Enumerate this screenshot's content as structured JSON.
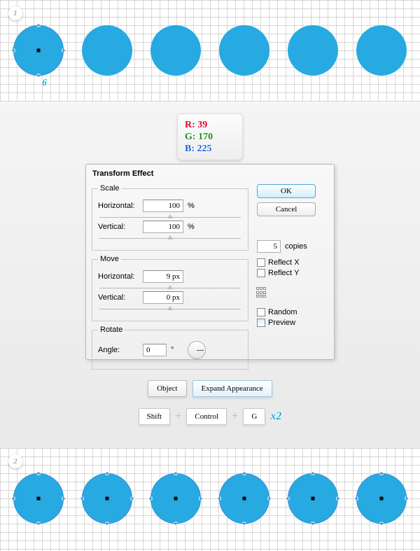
{
  "steps": {
    "s1": "1",
    "s2": "2"
  },
  "dims": {
    "w": "6",
    "h": "6"
  },
  "rgb": {
    "r_label": "R:",
    "g_label": "G:",
    "b_label": "B:",
    "r": "39",
    "g": "170",
    "b": "225"
  },
  "dialog": {
    "title": "Transform Effect",
    "scale": {
      "legend": "Scale",
      "h_label": "Horizontal:",
      "h_value": "100",
      "h_unit": "%",
      "v_label": "Vertical:",
      "v_value": "100",
      "v_unit": "%"
    },
    "move": {
      "legend": "Move",
      "h_label": "Horizontal:",
      "h_value": "9 px",
      "v_label": "Vertical:",
      "v_value": "0 px"
    },
    "rotate": {
      "legend": "Rotate",
      "angle_label": "Angle:",
      "angle_value": "0",
      "angle_unit": "°"
    },
    "buttons": {
      "ok": "OK",
      "cancel": "Cancel"
    },
    "copies_value": "5",
    "copies_label": "copies",
    "reflect_x": "Reflect X",
    "reflect_y": "Reflect Y",
    "random": "Random",
    "preview": "Preview"
  },
  "menu": {
    "object": "Object",
    "expand": "Expand Appearance"
  },
  "shortcut": {
    "shift": "Shift",
    "ctrl": "Control",
    "g": "G",
    "plus": "+",
    "x2": "x2"
  },
  "color": {
    "circle": "#27aae1"
  }
}
